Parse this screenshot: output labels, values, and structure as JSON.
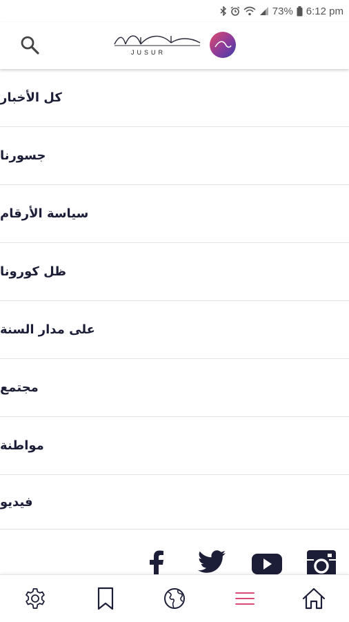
{
  "status_bar": {
    "battery": "73%",
    "time": "6:12 pm",
    "icons": [
      "bluetooth-icon",
      "alarm-icon",
      "wifi-icon",
      "signal-icon",
      "battery-icon"
    ]
  },
  "header": {
    "logo_text": "JUSUR",
    "search_icon": "search-icon"
  },
  "menu": {
    "items": [
      {
        "label": "كل الأخبار"
      },
      {
        "label": "جسورنا"
      },
      {
        "label": "سياسة الأرقام"
      },
      {
        "label": "ظل كورونا"
      },
      {
        "label": "على مدار السنة"
      },
      {
        "label": "مجتمع"
      },
      {
        "label": "مواطنة"
      },
      {
        "label": "فيديو"
      }
    ]
  },
  "social": [
    "facebook-icon",
    "twitter-icon",
    "youtube-icon",
    "instagram-icon"
  ],
  "bottom_nav": {
    "items": [
      "settings-icon",
      "bookmark-icon",
      "globe-icon",
      "menu-icon",
      "home-icon"
    ],
    "active": "menu-icon"
  },
  "colors": {
    "text": "#1c1d36",
    "accent": "#d64a75",
    "icon": "#1c1d36"
  }
}
